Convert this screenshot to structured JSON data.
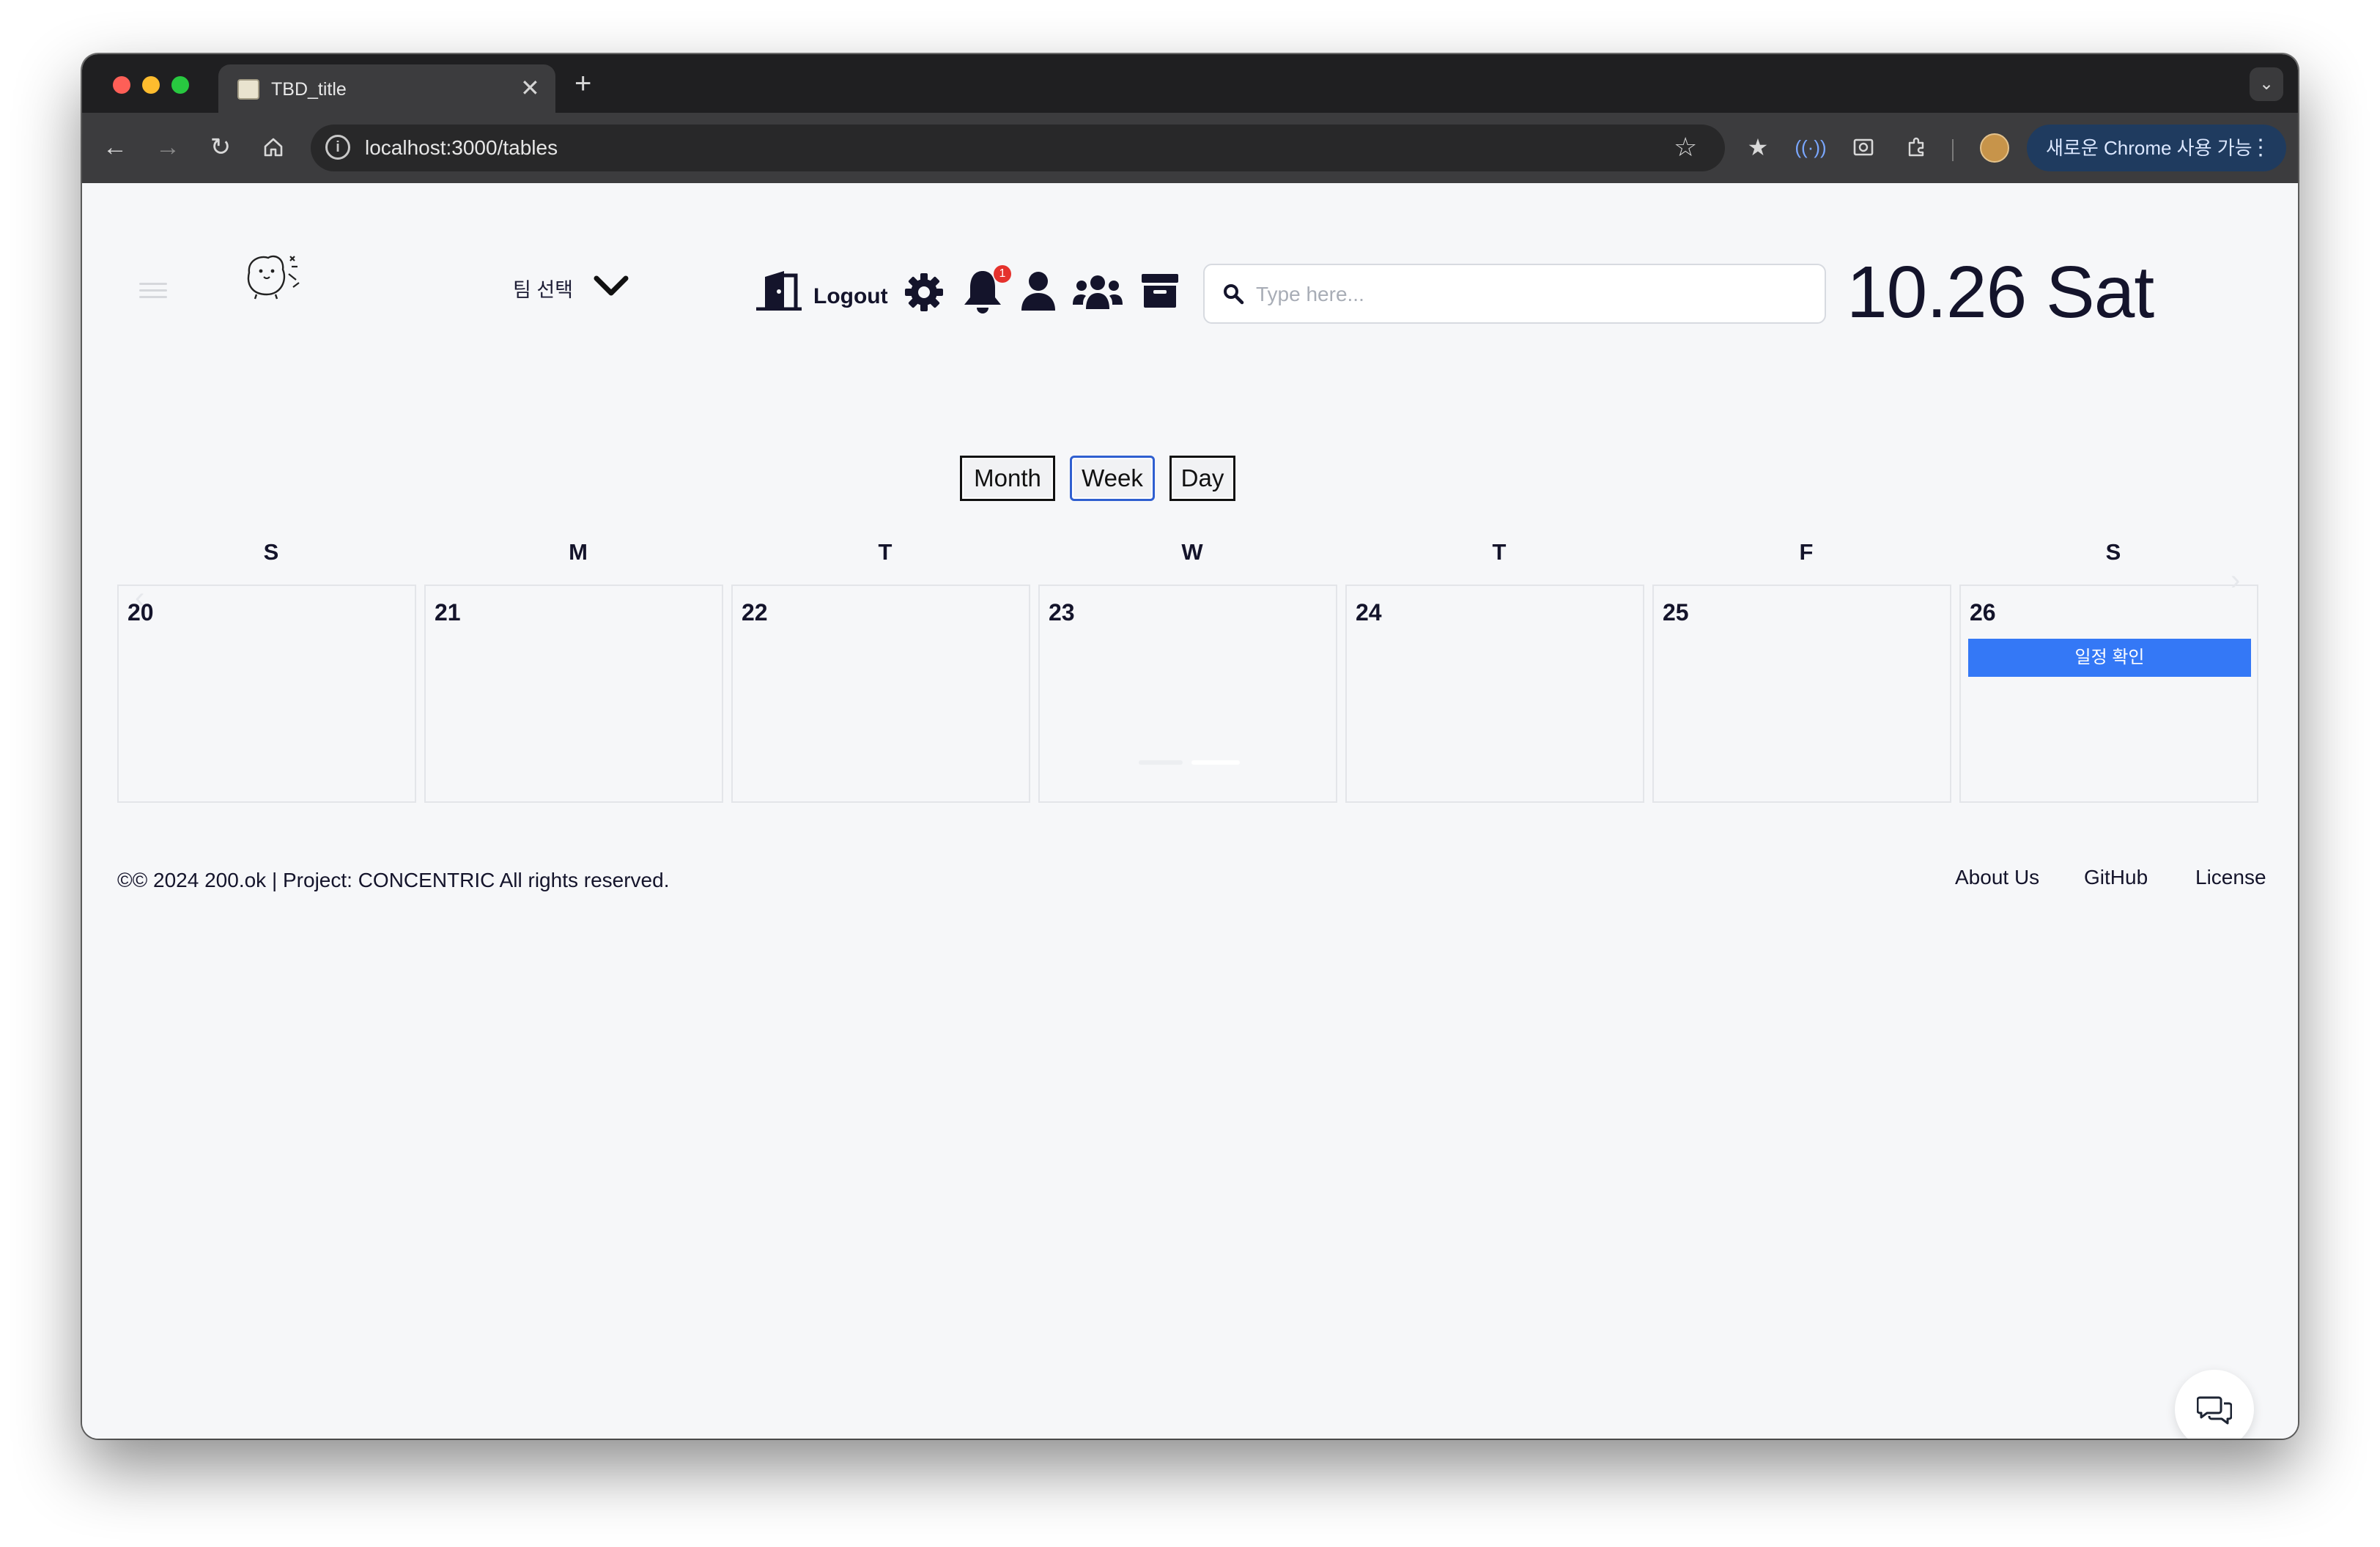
{
  "browser": {
    "tab_title": "TBD_title",
    "tab_close": "✕",
    "new_tab": "+",
    "url": "localhost:3000/tables",
    "update_button": "새로운 Chrome 사용 가능",
    "icons": [
      "back-arrow-icon",
      "forward-arrow-icon",
      "reload-icon",
      "home-icon",
      "info-icon",
      "bookmark-star-icon",
      "bookmarks-icon",
      "sign-icon",
      "screenshot-icon",
      "extensions-icon",
      "profile-avatar",
      "menu-icon"
    ]
  },
  "header": {
    "team_select_label": "팀 선택",
    "logout_label": "Logout",
    "notification_count": "1",
    "search_placeholder": "Type here...",
    "search_value": "",
    "date_display": "10.26  Sat",
    "icons": [
      "hamburger-menu-icon",
      "hamster-logo",
      "chevron-down-icon",
      "door-logout-icon",
      "gear-icon",
      "bell-icon",
      "user-icon",
      "users-icon",
      "archive-icon",
      "search-icon"
    ]
  },
  "calendar": {
    "views": [
      "Month",
      "Week",
      "Day"
    ],
    "active_view": "Week",
    "weekdays": [
      "S",
      "M",
      "T",
      "W",
      "T",
      "F",
      "S"
    ],
    "days": [
      {
        "number": "20",
        "events": []
      },
      {
        "number": "21",
        "events": []
      },
      {
        "number": "22",
        "events": []
      },
      {
        "number": "23",
        "events": []
      },
      {
        "number": "24",
        "events": []
      },
      {
        "number": "25",
        "events": []
      },
      {
        "number": "26",
        "events": [
          "일정 확인"
        ]
      }
    ],
    "event_color": "#3478f6"
  },
  "footer": {
    "copyright": "©© 2024 200.ok | Project: CONCENTRIC All rights reserved.",
    "links": [
      "About Us",
      "GitHub",
      "License"
    ]
  },
  "chat": {
    "icon": "chat-bubbles-icon"
  },
  "colors": {
    "text": "#14142b",
    "page_bg": "#f6f7f9",
    "chrome_dark": "#1f1f21",
    "chrome_toolbar": "#3c3c3e",
    "accent": "#3478f6",
    "badge": "#e5322d"
  }
}
